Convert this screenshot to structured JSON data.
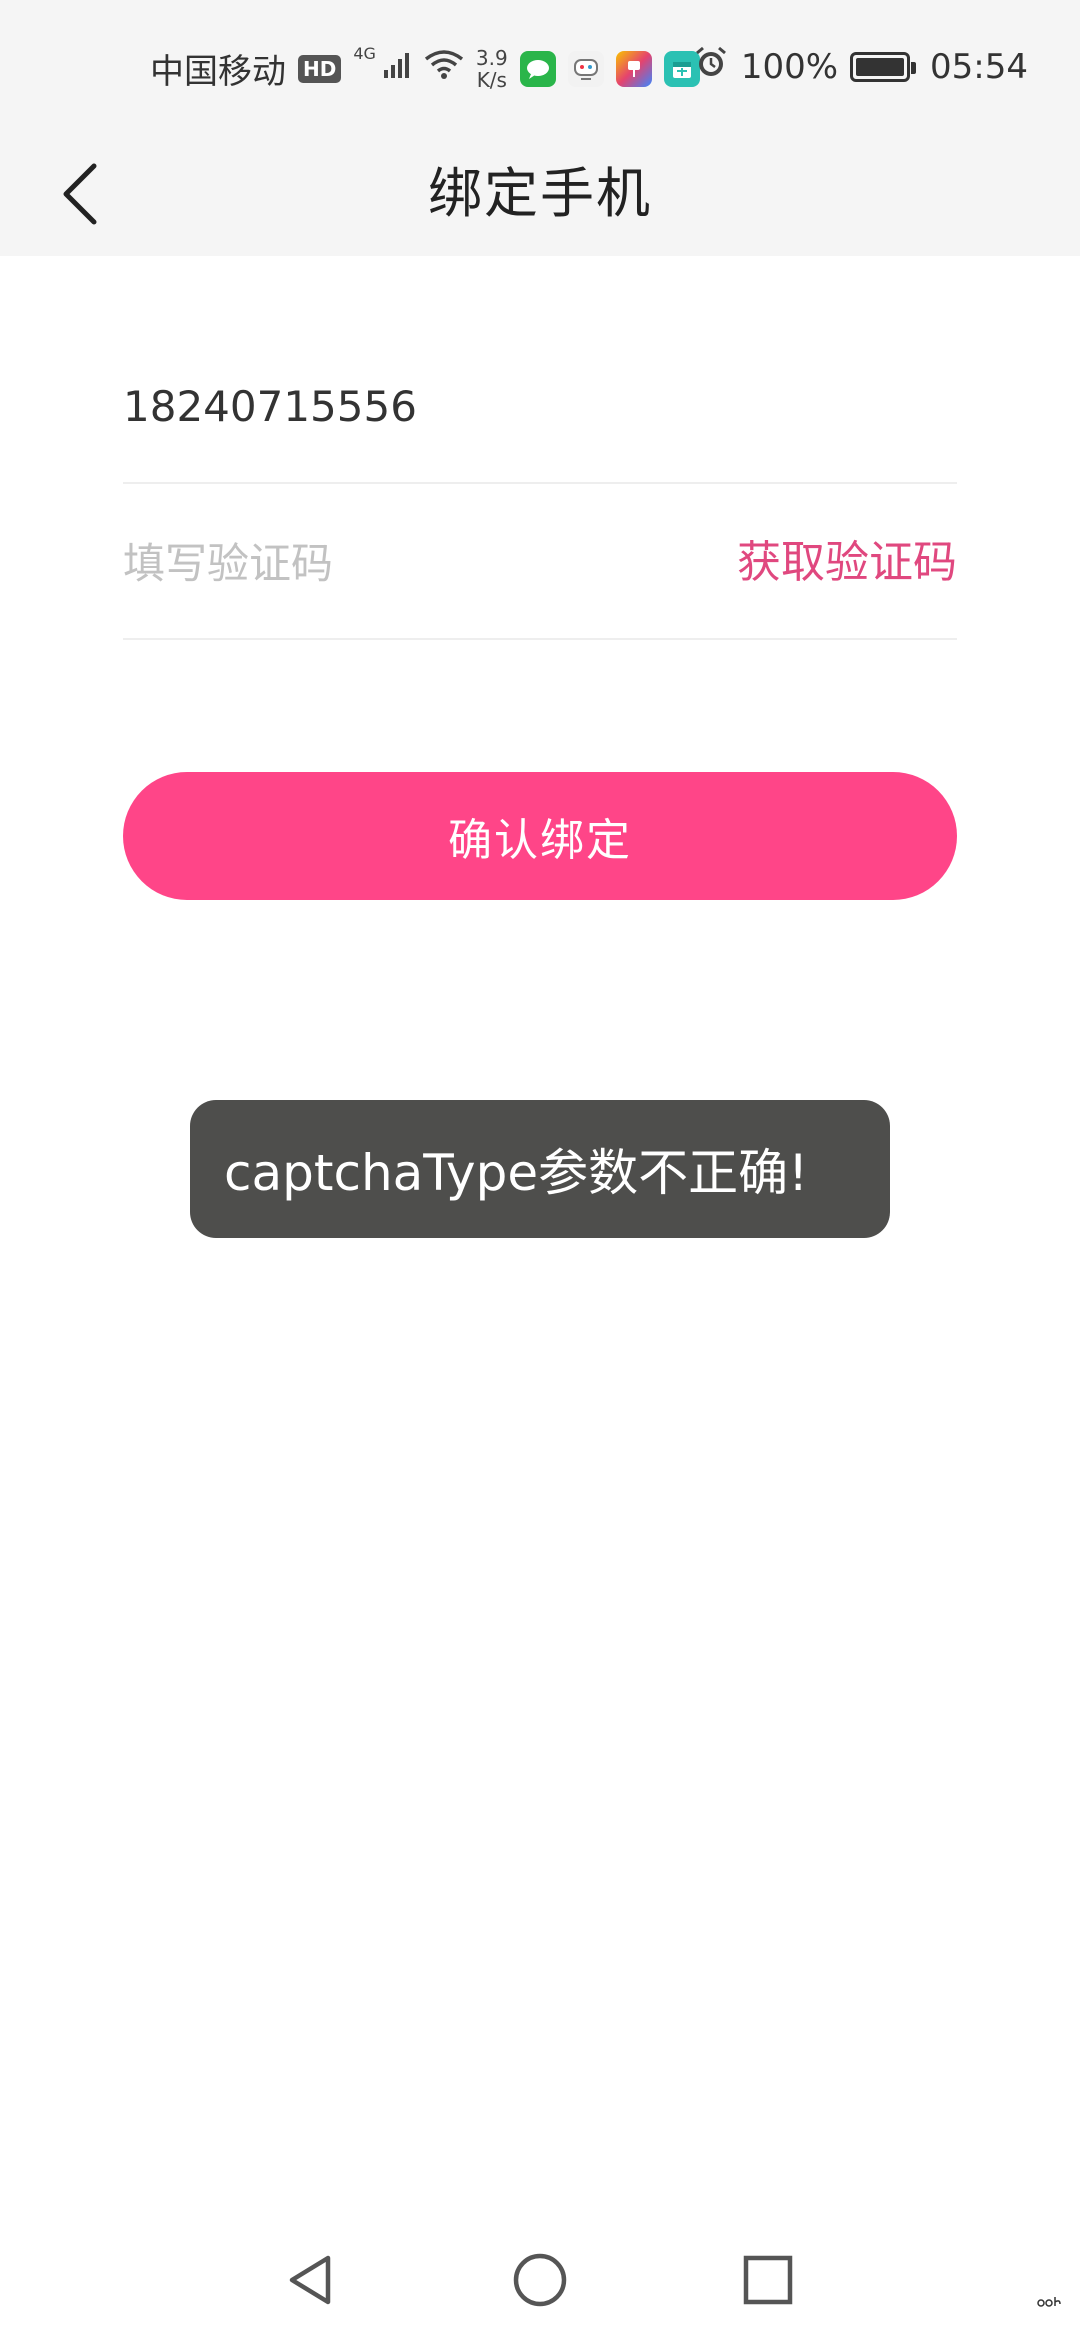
{
  "status_bar": {
    "carrier": "中国移动",
    "hd": "HD",
    "network": "4G",
    "speed_value": "3.9",
    "speed_unit": "K/s",
    "battery": "100%",
    "time": "05:54"
  },
  "header": {
    "title": "绑定手机",
    "back_icon": "chevron-left-icon"
  },
  "form": {
    "phone_value": "18240715556",
    "code_placeholder": "填写验证码",
    "code_value": "",
    "get_code_label": "获取验证码",
    "get_code_color": "#e0487f"
  },
  "confirm_button": {
    "label": "确认绑定",
    "color": "#ff4588"
  },
  "toast": {
    "message": "captchaType参数不正确!"
  },
  "nav_bar": {
    "icons": [
      "back-triangle-icon",
      "home-circle-icon",
      "recents-square-icon"
    ]
  }
}
